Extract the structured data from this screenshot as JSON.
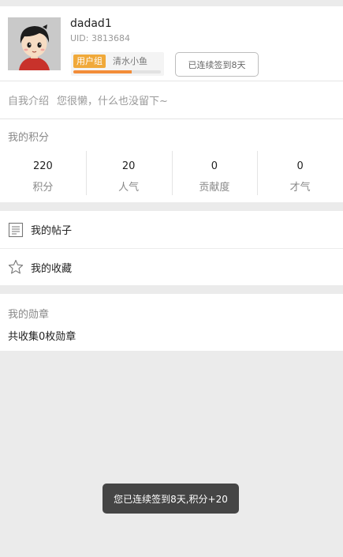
{
  "profile": {
    "username": "dadad1",
    "uid": "UID: 3813684",
    "group_badge": "用户组",
    "group_name": "清水小鱼",
    "group_progress": 0.67,
    "checkin_button": "已连续签到8天"
  },
  "intro": {
    "label": "自我介绍",
    "text": "您很懒，什么也没留下~"
  },
  "points": {
    "title": "我的积分",
    "stats": [
      {
        "value": "220",
        "label": "积分"
      },
      {
        "value": "20",
        "label": "人气"
      },
      {
        "value": "0",
        "label": "贡献度"
      },
      {
        "value": "0",
        "label": "才气"
      }
    ]
  },
  "menu": {
    "items": [
      {
        "label": "我的帖子",
        "icon": "document-icon"
      },
      {
        "label": "我的收藏",
        "icon": "star-icon"
      }
    ]
  },
  "medals": {
    "title": "我的勋章",
    "count_text": "共收集0枚勋章"
  },
  "toast": {
    "text": "您已连续签到8天,积分+20"
  },
  "colors": {
    "badge": "#f0a93a",
    "progress": "#f28c38",
    "background": "#ebebeb"
  }
}
